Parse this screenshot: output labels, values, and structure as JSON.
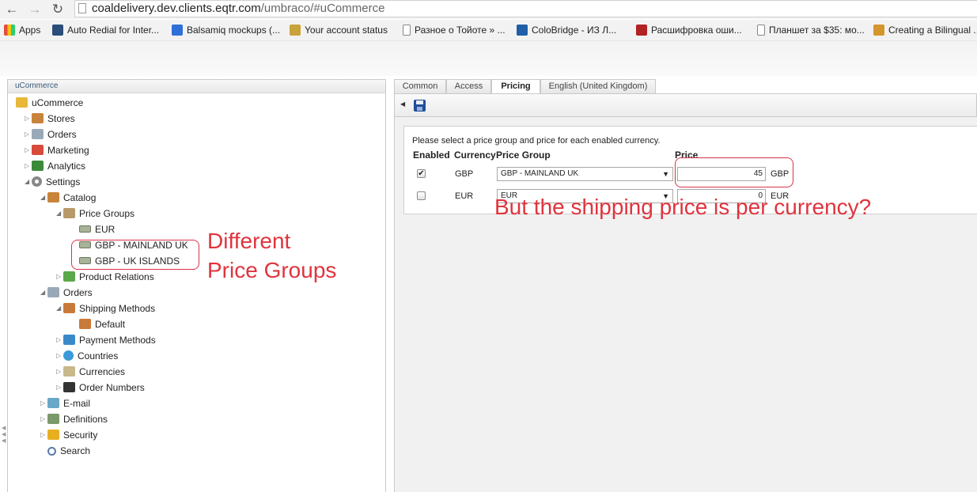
{
  "browser": {
    "url_host": "coaldelivery.dev.clients.eqtr.com",
    "url_path": "/umbraco/#uCommerce",
    "bookmarks": [
      {
        "label": "Apps",
        "icon": "apps-grid-icon",
        "color": "#e74c3c"
      },
      {
        "label": "Auto Redial for Inter...",
        "icon": "tn-icon",
        "color": "#2a4d7a"
      },
      {
        "label": "Balsamiq mockups (...",
        "icon": "balsamiq-icon",
        "color": "#2f6fd8"
      },
      {
        "label": "Your account status",
        "icon": "account-icon",
        "color": "#c9a23a"
      },
      {
        "label": "Разное о Тойоте » ...",
        "icon": "page-icon",
        "color": "#ffffff"
      },
      {
        "label": "ColoBridge - ИЗ Л...",
        "icon": "colobridge-icon",
        "color": "#1e5fa8"
      },
      {
        "label": "Расшифровка оши...",
        "icon": "elm-icon",
        "color": "#b22222"
      },
      {
        "label": "Планшет за $35: мо...",
        "icon": "page-icon",
        "color": "#ffffff"
      },
      {
        "label": "Creating a Bilingual ...",
        "icon": "creating-icon",
        "color": "#d4962a"
      }
    ]
  },
  "left_panel": {
    "title": "uCommerce",
    "tree": [
      {
        "label": "uCommerce",
        "icon": "folder-icon",
        "level": 0,
        "arrow": "",
        "color": "#e8b83a"
      },
      {
        "label": "Stores",
        "icon": "store-icon",
        "level": 1,
        "arrow": "collapsed",
        "color": "#c8843a"
      },
      {
        "label": "Orders",
        "icon": "orders-icon",
        "level": 1,
        "arrow": "collapsed",
        "color": "#9aa9b8"
      },
      {
        "label": "Marketing",
        "icon": "marketing-icon",
        "level": 1,
        "arrow": "collapsed",
        "color": "#d84a3a"
      },
      {
        "label": "Analytics",
        "icon": "analytics-icon",
        "level": 1,
        "arrow": "collapsed",
        "color": "#3a8a3a"
      },
      {
        "label": "Settings",
        "icon": "gear-icon",
        "level": 1,
        "arrow": "expanded",
        "color": "#888888"
      },
      {
        "label": "Catalog",
        "icon": "catalog-icon",
        "level": 2,
        "arrow": "expanded",
        "color": "#c8843a"
      },
      {
        "label": "Price Groups",
        "icon": "price-groups-icon",
        "level": 3,
        "arrow": "expanded",
        "color": "#b89a6a"
      },
      {
        "label": "EUR",
        "icon": "banknote-icon",
        "level": 4,
        "arrow": "",
        "color": "#a8b29a"
      },
      {
        "label": "GBP - MAINLAND UK",
        "icon": "banknote-icon",
        "level": 4,
        "arrow": "",
        "color": "#a8b29a"
      },
      {
        "label": "GBP - UK ISLANDS",
        "icon": "banknote-icon",
        "level": 4,
        "arrow": "",
        "color": "#a8b29a"
      },
      {
        "label": "Product Relations",
        "icon": "product-relations-icon",
        "level": 3,
        "arrow": "collapsed",
        "color": "#5aa84a"
      },
      {
        "label": "Orders",
        "icon": "orders-icon",
        "level": 2,
        "arrow": "expanded",
        "color": "#9aa9b8"
      },
      {
        "label": "Shipping Methods",
        "icon": "truck-icon",
        "level": 3,
        "arrow": "expanded",
        "color": "#c87a3a"
      },
      {
        "label": "Default",
        "icon": "truck-icon",
        "level": 4,
        "arrow": "",
        "color": "#c87a3a"
      },
      {
        "label": "Payment Methods",
        "icon": "payment-icon",
        "level": 3,
        "arrow": "collapsed",
        "color": "#3a8ac8"
      },
      {
        "label": "Countries",
        "icon": "globe-icon",
        "level": 3,
        "arrow": "collapsed",
        "color": "#3a9ad8"
      },
      {
        "label": "Currencies",
        "icon": "currency-icon",
        "level": 3,
        "arrow": "collapsed",
        "color": "#c8b88a"
      },
      {
        "label": "Order Numbers",
        "icon": "order-numbers-icon",
        "level": 3,
        "arrow": "collapsed",
        "color": "#333333"
      },
      {
        "label": "E-mail",
        "icon": "email-icon",
        "level": 2,
        "arrow": "collapsed",
        "color": "#6aa8c8"
      },
      {
        "label": "Definitions",
        "icon": "definitions-icon",
        "level": 2,
        "arrow": "collapsed",
        "color": "#7a9a6a"
      },
      {
        "label": "Security",
        "icon": "lock-icon",
        "level": 2,
        "arrow": "collapsed",
        "color": "#e8b020"
      },
      {
        "label": "Search",
        "icon": "search-icon",
        "level": 2,
        "arrow": "",
        "color": "#5a7aa8"
      }
    ]
  },
  "tabs": [
    {
      "label": "Common",
      "active": false
    },
    {
      "label": "Access",
      "active": false
    },
    {
      "label": "Pricing",
      "active": true
    },
    {
      "label": "English (United Kingdom)",
      "active": false
    }
  ],
  "pricing": {
    "instruction": "Please select a price group and price for each enabled currency.",
    "headers": {
      "enabled": "Enabled",
      "currency": "Currency",
      "price_group": "Price Group",
      "price": "Price"
    },
    "rows": [
      {
        "enabled": true,
        "currency": "GBP",
        "price_group": "GBP - MAINLAND UK",
        "price": "45",
        "unit": "GBP"
      },
      {
        "enabled": false,
        "currency": "EUR",
        "price_group": "EUR",
        "price": "0",
        "unit": "EUR"
      }
    ]
  },
  "annotations": {
    "left_note_line1": "Different",
    "left_note_line2": "Price Groups",
    "right_note": "But the shipping price is per currency?",
    "color": "#e0343d"
  }
}
